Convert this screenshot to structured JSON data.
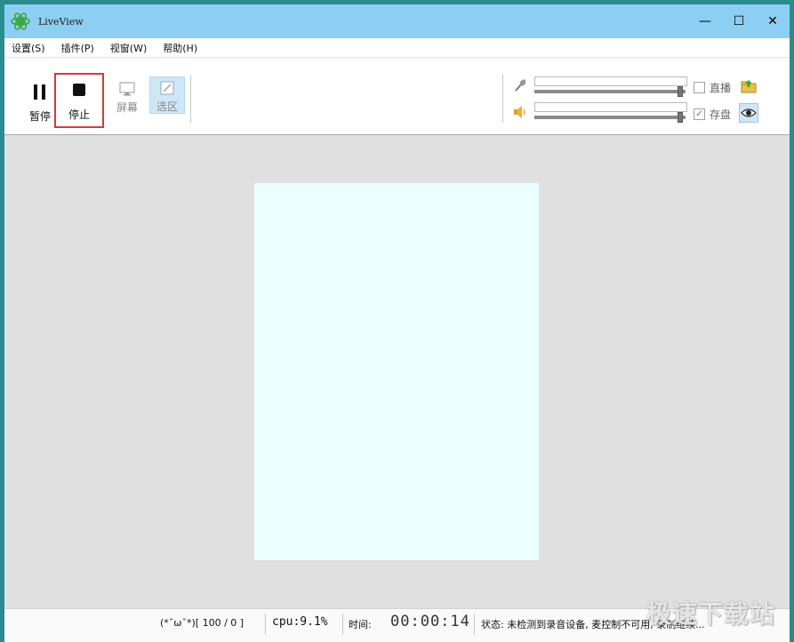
{
  "window": {
    "title": "LiveView",
    "minimize": "—",
    "maximize": "☐",
    "close": "✕"
  },
  "menu": [
    "设置(S)",
    "插件(P)",
    "视窗(W)",
    "帮助(H)"
  ],
  "toolbar": {
    "pause_label": "暂停",
    "stop_label": "停止",
    "screen_label": "屏幕",
    "region_label": "选区"
  },
  "audio": {
    "mic_level": 0.98,
    "speaker_level": 0.98,
    "live_label": "直播",
    "live_checked": false,
    "save_label": "存盘",
    "save_checked": true,
    "check_mark": "✓"
  },
  "status": {
    "face": "(*ˇωˇ*)[ 100 / 0 ]",
    "cpu": "cpu:9.1%",
    "time_label": "时间:",
    "clock": "00:00:14",
    "state": "状态:  未检测到录音设备, 麦控制不可用, 录制继续..."
  },
  "watermark": "极速下载站",
  "colors": {
    "titlebar": "#8ccff3",
    "stop_highlight": "#d53a3a",
    "preview": "#eafffe"
  }
}
